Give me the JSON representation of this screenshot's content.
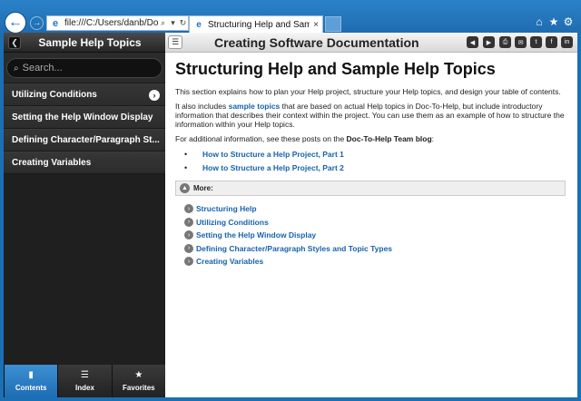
{
  "browser": {
    "address_url": "file:///C:/Users/danb/Docum",
    "search_icon": "search-icon",
    "dropdown_icon": "chevron-down-icon",
    "refresh_icon": "refresh-icon",
    "tab_title": "Structuring Help and Sampl...",
    "tab_close": "×",
    "tools": [
      "home-icon",
      "star-icon",
      "gear-icon"
    ]
  },
  "left_panel": {
    "title": "Sample Help Topics",
    "search_placeholder": "Search...",
    "nav_items": [
      {
        "label": "Utilizing Conditions",
        "has_chevron": true
      },
      {
        "label": "Setting the Help Window Display"
      },
      {
        "label": "Defining Character/Paragraph St..."
      },
      {
        "label": "Creating Variables"
      }
    ],
    "tabs": [
      {
        "label": "Contents",
        "icon": "book-icon",
        "active": true
      },
      {
        "label": "Index",
        "icon": "list-icon"
      },
      {
        "label": "Favorites",
        "icon": "star-icon"
      }
    ]
  },
  "topic": {
    "header_title": "Creating Software Documentation",
    "header_buttons": [
      "previous-icon",
      "next-icon",
      "print-icon",
      "email-icon",
      "twitter-icon",
      "facebook-icon",
      "linkedin-icon"
    ],
    "title": "Structuring Help and Sample Help Topics",
    "para1": "This section explains how to plan your Help project, structure your Help topics, and design your table of contents.",
    "para2_pre": "It also includes ",
    "para2_link": "sample topics",
    "para2_post": "  that are based on actual Help topics in Doc-To-Help, but include introductory information that describes their context within the project. You can use them as an example of how to structure the information within your Help topics.",
    "para3_pre": "For additional information, see these posts on the ",
    "para3_bold": "Doc-To-Help Team blog",
    "para3_post": ":",
    "blog_links": [
      "How to Structure a Help Project, Part 1",
      "How to Structure a Help Project, Part 2"
    ],
    "more_label": "More:",
    "more_links": [
      "Structuring Help",
      "Utilizing Conditions",
      "Setting the Help Window Display",
      "Defining Character/Paragraph Styles and Topic Types",
      "Creating Variables"
    ]
  }
}
